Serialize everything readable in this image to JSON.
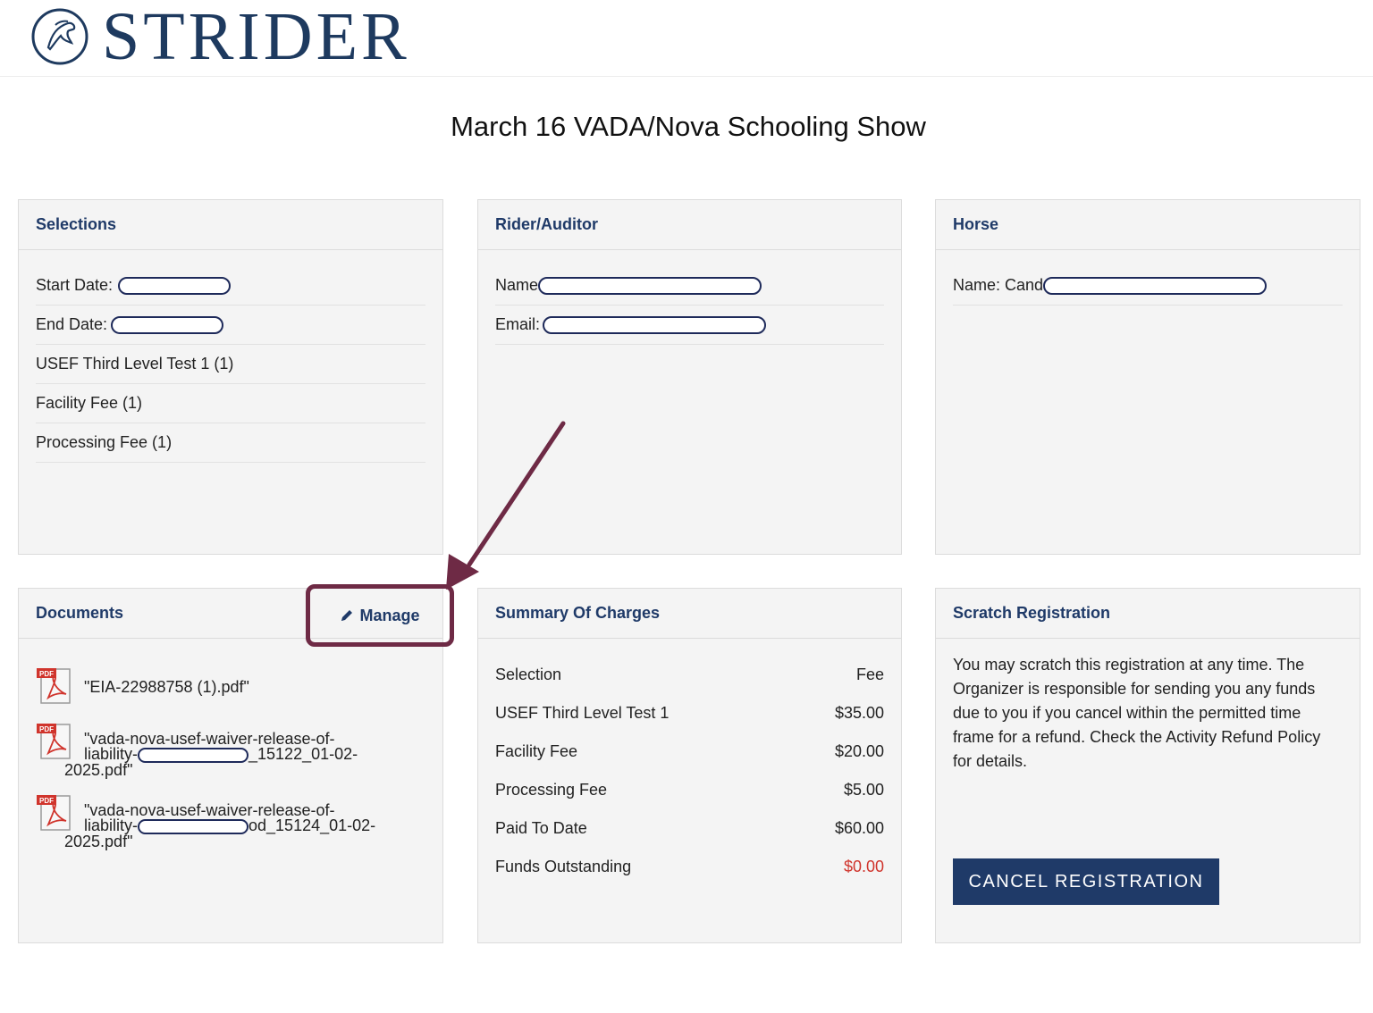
{
  "brand": {
    "name": "STRIDER"
  },
  "page": {
    "title": "March 16 VADA/Nova Schooling Show"
  },
  "selections": {
    "title": "Selections",
    "start_label": "Start Date:",
    "end_label": "End Date:",
    "items": [
      "USEF Third Level Test 1 (1)",
      "Facility Fee (1)",
      "Processing Fee (1)"
    ]
  },
  "rider": {
    "title": "Rider/Auditor",
    "name_label": "Name",
    "email_label": "Email:"
  },
  "horse": {
    "title": "Horse",
    "name_label": "Name: Cand"
  },
  "documents": {
    "title": "Documents",
    "manage_label": "Manage",
    "files": [
      {
        "line1": "\"EIA-22988758 (1).pdf\""
      },
      {
        "line1": "\"vada-nova-usef-waiver-release-of-",
        "line2a": "liability-",
        "line2b": "_15122_01-02-",
        "line3": "2025.pdf\""
      },
      {
        "line1": "\"vada-nova-usef-waiver-release-of-",
        "line2a": "liability-",
        "line2b": "od_15124_01-02-",
        "line3": "2025.pdf\""
      }
    ]
  },
  "charges": {
    "title": "Summary Of Charges",
    "header": {
      "label": "Selection",
      "value": "Fee"
    },
    "rows": [
      {
        "label": "USEF Third Level Test 1",
        "value": "$35.00"
      },
      {
        "label": "Facility Fee",
        "value": "$20.00"
      },
      {
        "label": "Processing Fee",
        "value": "$5.00"
      },
      {
        "label": "Paid To Date",
        "value": "$60.00"
      }
    ],
    "outstanding": {
      "label": "Funds Outstanding",
      "value": "$0.00"
    }
  },
  "scratch": {
    "title": "Scratch Registration",
    "text": "You may scratch this registration at any time. The Organizer is responsible for sending you any funds due to you if you cancel within the permitted time frame for a refund. Check the Activity Refund Policy for details.",
    "cancel_label": "CANCEL REGISTRATION"
  },
  "colors": {
    "brand": "#1e3a5f",
    "header_text": "#1f3a68",
    "annotation": "#6e2a45",
    "outstanding": "#d0342c"
  },
  "icons": [
    "horse-logo-icon",
    "pencil-icon",
    "pdf-icon"
  ]
}
